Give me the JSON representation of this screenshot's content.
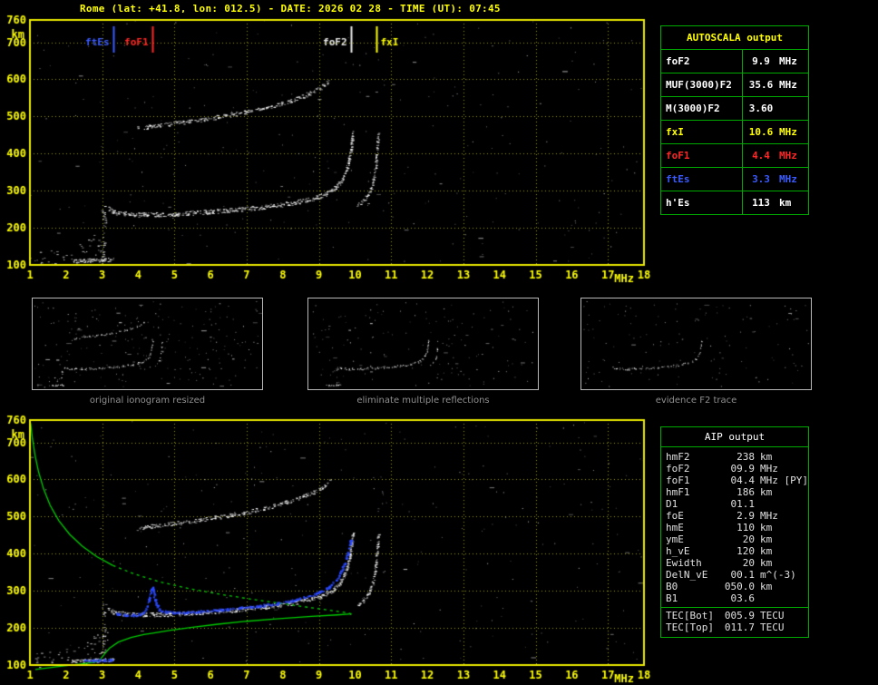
{
  "title": "Rome (lat: +41.8, lon: 012.5) - DATE: 2026 02 28 - TIME (UT): 07:45",
  "autoscala_table": {
    "header": "AUTOSCALA output",
    "rows": [
      {
        "label": "foF2",
        "value": "9.9",
        "unit": "MHz",
        "color": "#ffffff"
      },
      {
        "label": "MUF(3000)F2",
        "value": "35.6",
        "unit": "MHz",
        "color": "#ffffff"
      },
      {
        "label": "M(3000)F2",
        "value": "3.60",
        "unit": "",
        "color": "#ffffff"
      },
      {
        "label": "fxI",
        "value": "10.6",
        "unit": "MHz",
        "color": "#ffff00"
      },
      {
        "label": "foF1",
        "value": "4.4",
        "unit": "MHz",
        "color": "#ff2626"
      },
      {
        "label": "ftEs",
        "value": "3.3",
        "unit": "MHz",
        "color": "#3a5bff"
      },
      {
        "label": "h'Es",
        "value": "113",
        "unit": "km",
        "color": "#ffffff"
      }
    ]
  },
  "aip_table": {
    "header": "AIP output",
    "rows": [
      {
        "label": "hmF2",
        "value": "238",
        "unit": "km"
      },
      {
        "label": "foF2",
        "value": "09.9",
        "unit": "MHz"
      },
      {
        "label": "foF1",
        "value": "04.4",
        "unit": "MHz [PY]"
      },
      {
        "label": "hmF1",
        "value": "186",
        "unit": "km"
      },
      {
        "label": "D1",
        "value": "01.1",
        "unit": ""
      },
      {
        "label": "foE",
        "value": "2.9",
        "unit": "MHz"
      },
      {
        "label": "hmE",
        "value": "110",
        "unit": "km"
      },
      {
        "label": "ymE",
        "value": "20",
        "unit": "km"
      },
      {
        "label": "h_vE",
        "value": "120",
        "unit": "km"
      },
      {
        "label": "Ewidth",
        "value": "20",
        "unit": "km"
      },
      {
        "label": "DelN_vE",
        "value": "00.1",
        "unit": "m^(-3)"
      },
      {
        "label": "B0",
        "value": "050.0",
        "unit": "km"
      },
      {
        "label": "B1",
        "value": "03.6",
        "unit": ""
      },
      {
        "label": "TEC[Bot]",
        "value": "005.9",
        "unit": "TECU",
        "sep_before": true
      },
      {
        "label": "TEC[Top]",
        "value": "011.7",
        "unit": "TECU"
      }
    ]
  },
  "thumbnails": [
    {
      "caption": "original ionogram resized"
    },
    {
      "caption": "eliminate multiple reflections"
    },
    {
      "caption": "evidence F2 trace"
    }
  ],
  "chart_data": {
    "type": "scatter",
    "title": "Ionogram, Rome, 2026-02-28 07:45 UT",
    "xlabel": "MHz",
    "ylabel": "km",
    "xlim": [
      1,
      18
    ],
    "ylim": [
      100,
      760
    ],
    "x_ticks": [
      1,
      2,
      3,
      4,
      5,
      6,
      7,
      8,
      9,
      10,
      11,
      12,
      13,
      14,
      15,
      16,
      17,
      18
    ],
    "y_ticks": [
      100,
      200,
      300,
      400,
      500,
      600,
      700,
      760
    ],
    "grid": {
      "x_lines": [
        3,
        5,
        7,
        9,
        11,
        13,
        15,
        17
      ],
      "y_lines": [
        200,
        300,
        400,
        500,
        600,
        700
      ]
    },
    "colors": {
      "axis": "#ffff00",
      "grid": "#9b9b00",
      "frame": "#e8e800",
      "echo": "#ffffff",
      "profile": "#00cc00",
      "restored": "#2b49ff"
    },
    "markers": [
      {
        "label": "ftEs",
        "freq": 3.3,
        "color": "#3a5bff",
        "label_side": "left"
      },
      {
        "label": "foF1",
        "freq": 4.4,
        "color": "#ff2626",
        "label_side": "left"
      },
      {
        "label": "foF2",
        "freq": 9.9,
        "color": "#e8e8e8",
        "label_side": "left"
      },
      {
        "label": "fxI",
        "freq": 10.6,
        "color": "#ffff00",
        "label_side": "right"
      }
    ],
    "traces": {
      "f_trace": {
        "color": "#ffffff",
        "density": 1.5,
        "jitter": 2.4,
        "jx": 0.9,
        "points": [
          [
            3.15,
            252
          ],
          [
            3.3,
            243
          ],
          [
            3.6,
            238
          ],
          [
            4.0,
            236
          ],
          [
            4.4,
            236
          ],
          [
            4.8,
            237
          ],
          [
            5.2,
            239
          ],
          [
            5.6,
            241
          ],
          [
            6.0,
            244
          ],
          [
            6.4,
            247
          ],
          [
            6.8,
            250
          ],
          [
            7.2,
            254
          ],
          [
            7.6,
            258
          ],
          [
            8.0,
            263
          ],
          [
            8.3,
            268
          ],
          [
            8.6,
            274
          ],
          [
            8.9,
            281
          ],
          [
            9.15,
            290
          ],
          [
            9.35,
            301
          ],
          [
            9.5,
            314
          ],
          [
            9.63,
            330
          ],
          [
            9.73,
            350
          ],
          [
            9.8,
            374
          ],
          [
            9.86,
            402
          ],
          [
            9.9,
            432
          ],
          [
            9.93,
            455
          ]
        ]
      },
      "second_trace": {
        "color": "#ffffff",
        "density": 1.1,
        "jitter": 2.2,
        "jx": 0.9,
        "points": [
          [
            3.95,
            468
          ],
          [
            4.35,
            474
          ],
          [
            4.75,
            479
          ],
          [
            5.15,
            484
          ],
          [
            5.55,
            489
          ],
          [
            5.95,
            495
          ],
          [
            6.35,
            501
          ],
          [
            6.75,
            508
          ],
          [
            7.15,
            516
          ],
          [
            7.55,
            525
          ],
          [
            7.95,
            535
          ],
          [
            8.3,
            546
          ],
          [
            8.6,
            557
          ],
          [
            8.9,
            570
          ],
          [
            9.12,
            583
          ],
          [
            9.28,
            596
          ]
        ]
      },
      "x_trace": {
        "color": "#ffffff",
        "density": 1.0,
        "jitter": 2.2,
        "jx": 0.9,
        "points": [
          [
            10.05,
            260
          ],
          [
            10.18,
            270
          ],
          [
            10.3,
            283
          ],
          [
            10.4,
            299
          ],
          [
            10.48,
            320
          ],
          [
            10.54,
            350
          ],
          [
            10.58,
            388
          ],
          [
            10.61,
            425
          ],
          [
            10.63,
            452
          ]
        ]
      },
      "es": {
        "color": "#ffffff",
        "density": 1.7,
        "jitter": 2.0,
        "jx": 0.9,
        "points": [
          [
            2.15,
            110
          ],
          [
            2.6,
            112
          ],
          [
            3.0,
            114
          ],
          [
            3.3,
            115
          ]
        ]
      },
      "es_cloud": {
        "color": "#dcdcdc",
        "density": 0.7,
        "jitter": 13,
        "jx": 4,
        "points": [
          [
            2.35,
            128
          ],
          [
            2.62,
            142
          ],
          [
            2.9,
            157
          ],
          [
            3.08,
            170
          ]
        ]
      },
      "es_spread": {
        "color": "#e6e6e6",
        "density": 0.5,
        "jitter": 7,
        "jx": 2.5,
        "points": [
          [
            3.0,
            118
          ],
          [
            3.03,
            172
          ],
          [
            3.05,
            228
          ],
          [
            3.02,
            270
          ]
        ]
      },
      "corner": {
        "color": "#cfcfcf",
        "density": 0.5,
        "jitter": 9,
        "jx": 6,
        "points": [
          [
            1.05,
            112
          ],
          [
            1.6,
            118
          ],
          [
            2.15,
            124
          ]
        ]
      }
    },
    "profile": {
      "color": "#00cc00",
      "width": 1.3,
      "segments": [
        {
          "dash": [],
          "points": [
            [
              1.15,
              88
            ],
            [
              1.8,
              96
            ],
            [
              2.4,
              103
            ],
            [
              2.75,
              107
            ],
            [
              2.9,
              110
            ],
            [
              2.97,
              118
            ],
            [
              3.05,
              128
            ],
            [
              3.2,
              145
            ],
            [
              3.45,
              162
            ],
            [
              3.8,
              174
            ],
            [
              4.15,
              182
            ],
            [
              4.4,
              186
            ],
            [
              4.9,
              194
            ],
            [
              5.5,
              202
            ],
            [
              6.2,
              210
            ],
            [
              7.0,
              218
            ],
            [
              7.9,
              225
            ],
            [
              8.8,
              231
            ],
            [
              9.5,
              235
            ],
            [
              9.9,
              238
            ]
          ]
        },
        {
          "dash": [],
          "points": [
            [
              1.02,
              752
            ],
            [
              1.07,
              710
            ],
            [
              1.14,
              666
            ],
            [
              1.24,
              620
            ],
            [
              1.38,
              574
            ],
            [
              1.56,
              530
            ],
            [
              1.8,
              489
            ],
            [
              2.1,
              452
            ],
            [
              2.45,
              420
            ],
            [
              2.85,
              392
            ],
            [
              3.3,
              368
            ]
          ]
        },
        {
          "dash": [
            3,
            4
          ],
          "points": [
            [
              3.3,
              368
            ],
            [
              3.9,
              345
            ],
            [
              4.6,
              324
            ],
            [
              5.4,
              306
            ],
            [
              6.3,
              290
            ],
            [
              7.3,
              275
            ],
            [
              8.3,
              261
            ],
            [
              9.2,
              249
            ],
            [
              9.7,
              242
            ],
            [
              9.9,
              238
            ]
          ]
        }
      ]
    },
    "restored_trace": {
      "color": "#2b49ff",
      "density": 1.2,
      "jitter": 1.2,
      "jx": 0.8,
      "dot": [
        2,
        2
      ],
      "points": [
        [
          3.3,
          241
        ],
        [
          3.6,
          237
        ],
        [
          3.9,
          236
        ],
        [
          4.1,
          240
        ],
        [
          4.22,
          257
        ],
        [
          4.3,
          282
        ],
        [
          4.38,
          312
        ],
        [
          4.46,
          272
        ],
        [
          4.56,
          250
        ],
        [
          4.8,
          244
        ],
        [
          5.2,
          243
        ],
        [
          5.6,
          245
        ],
        [
          6.0,
          248
        ],
        [
          6.4,
          251
        ],
        [
          6.8,
          255
        ],
        [
          7.2,
          259
        ],
        [
          7.6,
          264
        ],
        [
          8.0,
          270
        ],
        [
          8.35,
          277
        ],
        [
          8.7,
          286
        ],
        [
          9.0,
          297
        ],
        [
          9.25,
          311
        ],
        [
          9.45,
          329
        ],
        [
          9.6,
          352
        ],
        [
          9.72,
          381
        ],
        [
          9.82,
          414
        ],
        [
          9.88,
          445
        ]
      ]
    },
    "restored_es": {
      "color": "#2b49ff",
      "density": 1.2,
      "jitter": 1.0,
      "jx": 0.8,
      "dot": [
        2,
        2
      ],
      "points": [
        [
          2.5,
          113
        ],
        [
          2.9,
          114
        ],
        [
          3.3,
          115
        ]
      ]
    },
    "plots": {
      "top": {
        "canvas": "topPlot",
        "seed": 7,
        "noise": 270,
        "markers": true,
        "profile": false,
        "restored": false,
        "traces": [
          "corner",
          "es",
          "es_cloud",
          "es_spread",
          "f_trace",
          "second_trace",
          "x_trace"
        ]
      },
      "bottom": {
        "canvas": "botPlot",
        "seed": 13,
        "noise": 270,
        "markers": false,
        "profile": true,
        "restored": true,
        "traces": [
          "corner",
          "es",
          "es_cloud",
          "es_spread",
          "f_trace",
          "second_trace",
          "x_trace"
        ]
      }
    },
    "thumb_plots": [
      {
        "canvas": "thumb0",
        "seed": 21,
        "noise": 220,
        "traces": [
          "corner",
          "es",
          "es_cloud",
          "es_spread",
          "f_trace",
          "second_trace",
          "x_trace"
        ]
      },
      {
        "canvas": "thumb1",
        "seed": 22,
        "noise": 150,
        "traces": [
          "es",
          "es_spread",
          "f_trace",
          "x_trace"
        ]
      },
      {
        "canvas": "thumb2",
        "seed": 23,
        "noise": 130,
        "density": 0.4,
        "traces": [
          "f_trace"
        ]
      }
    ]
  }
}
